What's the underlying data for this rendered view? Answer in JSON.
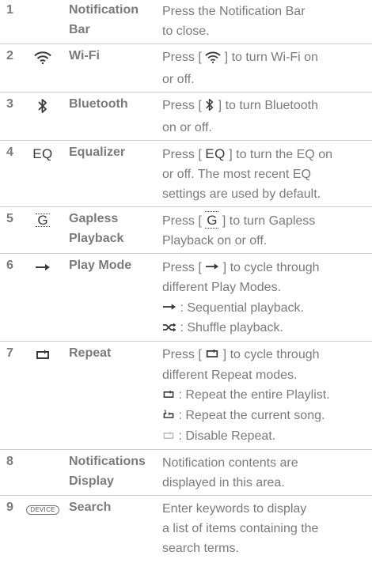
{
  "rows": [
    {
      "number": "1",
      "icon": "none",
      "name_lines": [
        "Notification",
        "Bar"
      ],
      "desc_lines": [
        "Press the Notification Bar",
        "to close."
      ]
    },
    {
      "number": "2",
      "icon": "wifi-icon",
      "name_lines": [
        "Wi-Fi"
      ],
      "desc": {
        "before": "Press [ ",
        "after": " ] to turn Wi-Fi on",
        "line2": "or off."
      }
    },
    {
      "number": "3",
      "icon": "bluetooth-icon",
      "name_lines": [
        "Bluetooth"
      ],
      "desc": {
        "before": "Press [ ",
        "after": " ] to turn Bluetooth",
        "line2": "on or off."
      }
    },
    {
      "number": "4",
      "icon_text": "EQ",
      "name_lines": [
        "Equalizer"
      ],
      "desc": {
        "before": "Press [ ",
        "after": " ] to turn the EQ on",
        "line2": "or off. The most recent EQ",
        "line3": "settings are used by default."
      }
    },
    {
      "number": "5",
      "icon_text": "G",
      "name_lines": [
        "Gapless",
        "Playback"
      ],
      "desc": {
        "before": "Press [ ",
        "after": " ] to turn Gapless",
        "line2": "Playback on or off."
      }
    },
    {
      "number": "6",
      "icon": "arrow-right-icon",
      "name_lines": [
        "Play Mode"
      ],
      "desc": {
        "before": "Press [ ",
        "after": " ] to cycle through",
        "line2": "different Play Modes.",
        "modes": [
          {
            "icon": "arrow-right-icon",
            "text": " : Sequential playback."
          },
          {
            "icon": "shuffle-icon",
            "text": " : Shuffle playback."
          }
        ]
      }
    },
    {
      "number": "7",
      "icon": "repeat-icon",
      "name_lines": [
        "Repeat"
      ],
      "desc": {
        "before": "Press [ ",
        "after": " ] to cycle through",
        "line2": "different Repeat modes.",
        "modes": [
          {
            "icon": "repeat-icon",
            "text": " : Repeat the entire Playlist."
          },
          {
            "icon": "repeat-one-icon",
            "text": " : Repeat the current song."
          },
          {
            "icon": "repeat-disabled-icon",
            "text": " : Disable Repeat."
          }
        ]
      }
    },
    {
      "number": "8",
      "icon": "none",
      "name_lines": [
        "Notifications",
        "Display"
      ],
      "desc_lines": [
        "Notification contents are",
        "displayed in this area."
      ]
    },
    {
      "number": "9",
      "icon_text": "DEVICE",
      "name_lines": [
        "Search"
      ],
      "desc_lines": [
        "Enter keywords to display",
        "a list of items containing the",
        "search terms."
      ]
    }
  ],
  "colors": {
    "text": "#7b7b7b",
    "icon": "#3a3a3a",
    "divider": "#cfcfcf",
    "faded_icon": "#c2c2c2"
  }
}
